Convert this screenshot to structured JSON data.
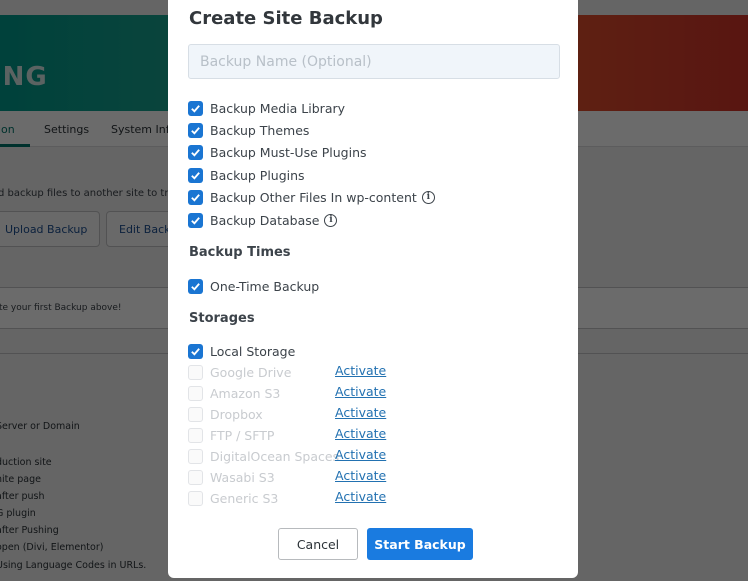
{
  "background": {
    "banner_title": "ING",
    "tabs": [
      {
        "label": "ion",
        "active": true
      },
      {
        "label": "Settings",
        "active": false
      },
      {
        "label": "System Info",
        "active": false
      }
    ],
    "description": "d backup files to another site to trans",
    "buttons": [
      {
        "label": "Upload Backup"
      },
      {
        "label": "Edit Backup"
      }
    ],
    "empty_message": "te your first Backup above!",
    "list_items": [
      "Server or Domain",
      "",
      "duction site",
      "hite page",
      " after push",
      "G plugin",
      "after Pushing",
      " open (Divi, Elementor)",
      "Using Language Codes in URLs."
    ],
    "colors": {
      "banner_start": "#009b8e",
      "banner_end": "#d2342a",
      "tab_active": "#00766b"
    }
  },
  "modal": {
    "title": "Create Site Backup",
    "name_input": {
      "value": "",
      "placeholder": "Backup Name (Optional)"
    },
    "backup_options": [
      {
        "label": "Backup Media Library",
        "checked": true,
        "info": false
      },
      {
        "label": "Backup Themes",
        "checked": true,
        "info": false
      },
      {
        "label": "Backup Must-Use Plugins",
        "checked": true,
        "info": false
      },
      {
        "label": "Backup Plugins",
        "checked": true,
        "info": false
      },
      {
        "label": "Backup Other Files In wp-content",
        "checked": true,
        "info": true
      },
      {
        "label": "Backup Database",
        "checked": true,
        "info": true
      }
    ],
    "backup_times": {
      "heading": "Backup Times",
      "options": [
        {
          "label": "One-Time Backup",
          "checked": true
        }
      ]
    },
    "storages": {
      "heading": "Storages",
      "options": [
        {
          "label": "Local Storage",
          "checked": true,
          "disabled": false,
          "action": ""
        },
        {
          "label": "Google Drive",
          "checked": false,
          "disabled": true,
          "action": "Activate"
        },
        {
          "label": "Amazon S3",
          "checked": false,
          "disabled": true,
          "action": "Activate"
        },
        {
          "label": "Dropbox",
          "checked": false,
          "disabled": true,
          "action": "Activate"
        },
        {
          "label": "FTP / SFTP",
          "checked": false,
          "disabled": true,
          "action": "Activate"
        },
        {
          "label": "DigitalOcean Spaces",
          "checked": false,
          "disabled": true,
          "action": "Activate"
        },
        {
          "label": "Wasabi S3",
          "checked": false,
          "disabled": true,
          "action": "Activate"
        },
        {
          "label": "Generic S3",
          "checked": false,
          "disabled": true,
          "action": "Activate"
        }
      ]
    },
    "cancel_label": "Cancel",
    "start_label": "Start Backup",
    "icons": {
      "check": "checkmark-icon",
      "info": "info-icon"
    },
    "colors": {
      "primary": "#1a7be0",
      "checkbox": "#1a75d2",
      "link": "#2271b1"
    }
  }
}
